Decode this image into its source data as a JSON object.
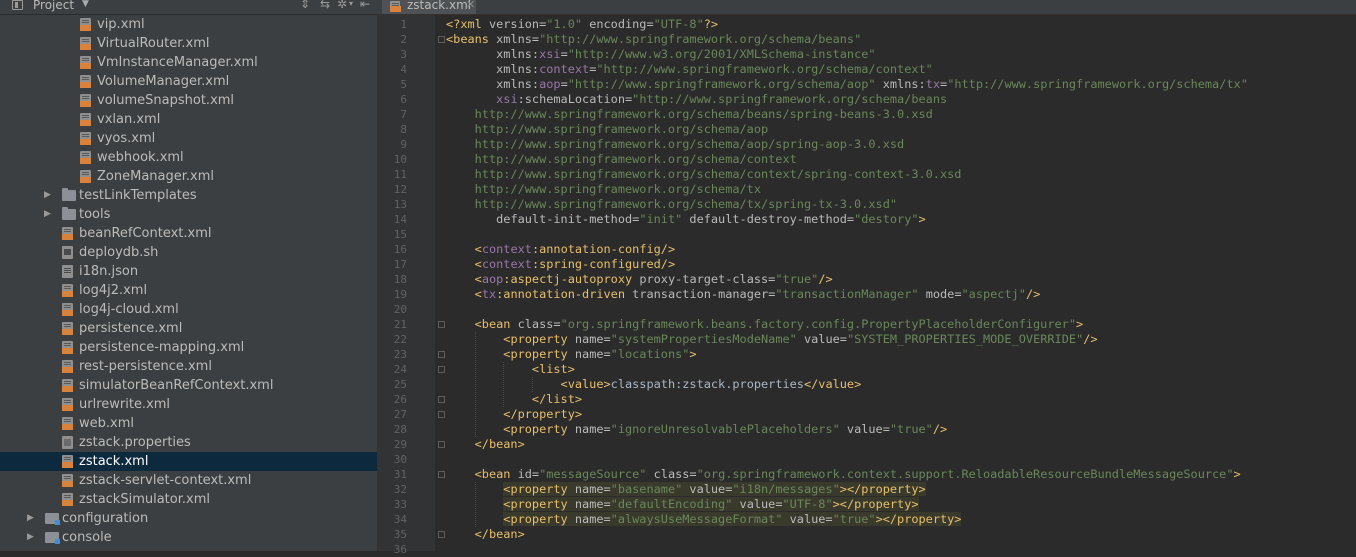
{
  "project_panel": {
    "title": "Project",
    "tree": [
      {
        "label": "vip.xml",
        "icon": "xml",
        "indent": 2
      },
      {
        "label": "VirtualRouter.xml",
        "icon": "xml",
        "indent": 2
      },
      {
        "label": "VmInstanceManager.xml",
        "icon": "xml",
        "indent": 2
      },
      {
        "label": "VolumeManager.xml",
        "icon": "xml",
        "indent": 2
      },
      {
        "label": "volumeSnapshot.xml",
        "icon": "xml",
        "indent": 2
      },
      {
        "label": "vxlan.xml",
        "icon": "xml",
        "indent": 2
      },
      {
        "label": "vyos.xml",
        "icon": "xml",
        "indent": 2
      },
      {
        "label": "webhook.xml",
        "icon": "xml",
        "indent": 2
      },
      {
        "label": "ZoneManager.xml",
        "icon": "xml",
        "indent": 2
      },
      {
        "label": "testLinkTemplates",
        "icon": "folder",
        "indent": 1,
        "collapsed": true
      },
      {
        "label": "tools",
        "icon": "folder",
        "indent": 1,
        "collapsed": true
      },
      {
        "label": "beanRefContext.xml",
        "icon": "xml",
        "indent": 1
      },
      {
        "label": "deploydb.sh",
        "icon": "sh",
        "indent": 1
      },
      {
        "label": "i18n.json",
        "icon": "json",
        "indent": 1
      },
      {
        "label": "log4j2.xml",
        "icon": "xml",
        "indent": 1
      },
      {
        "label": "log4j-cloud.xml",
        "icon": "xml",
        "indent": 1
      },
      {
        "label": "persistence.xml",
        "icon": "xml",
        "indent": 1
      },
      {
        "label": "persistence-mapping.xml",
        "icon": "xml",
        "indent": 1
      },
      {
        "label": "rest-persistence.xml",
        "icon": "xml",
        "indent": 1
      },
      {
        "label": "simulatorBeanRefContext.xml",
        "icon": "xml",
        "indent": 1
      },
      {
        "label": "urlrewrite.xml",
        "icon": "xml",
        "indent": 1
      },
      {
        "label": "web.xml",
        "icon": "xml",
        "indent": 1
      },
      {
        "label": "zstack.properties",
        "icon": "prop",
        "indent": 1
      },
      {
        "label": "zstack.xml",
        "icon": "xml",
        "indent": 1,
        "selected": true
      },
      {
        "label": "zstack-servlet-context.xml",
        "icon": "xml",
        "indent": 1
      },
      {
        "label": "zstackSimulator.xml",
        "icon": "xml",
        "indent": 1
      },
      {
        "label": "configuration",
        "icon": "module",
        "indent": 0,
        "collapsed": true
      },
      {
        "label": "console",
        "icon": "module",
        "indent": 0,
        "collapsed": true
      }
    ]
  },
  "editor": {
    "active_tab": "zstack.xml",
    "lines": [
      {
        "n": "1",
        "indent": "",
        "segs": [
          [
            "t",
            "<?xml "
          ],
          [
            "a",
            "version="
          ],
          [
            "v",
            "\"1.0\""
          ],
          [
            "a",
            " encoding="
          ],
          [
            "v",
            "\"UTF-8\""
          ],
          [
            "t",
            "?>"
          ]
        ]
      },
      {
        "n": "2",
        "indent": "",
        "fold": true,
        "segs": [
          [
            "t",
            "<beans "
          ],
          [
            "a",
            "xmlns="
          ],
          [
            "v",
            "\"http://www.springframework.org/schema/beans\""
          ]
        ]
      },
      {
        "n": "3",
        "indent": "       ",
        "segs": [
          [
            "a",
            "xmlns:"
          ],
          [
            "n",
            "xsi"
          ],
          [
            "a",
            "="
          ],
          [
            "v",
            "\"http://www.w3.org/2001/XMLSchema-instance\""
          ]
        ]
      },
      {
        "n": "4",
        "indent": "       ",
        "segs": [
          [
            "a",
            "xmlns:"
          ],
          [
            "n",
            "context"
          ],
          [
            "a",
            "="
          ],
          [
            "v",
            "\"http://www.springframework.org/schema/context\""
          ]
        ]
      },
      {
        "n": "5",
        "indent": "       ",
        "segs": [
          [
            "a",
            "xmlns:"
          ],
          [
            "n",
            "aop"
          ],
          [
            "a",
            "="
          ],
          [
            "v",
            "\"http://www.springframework.org/schema/aop\""
          ],
          [
            "a",
            " xmlns:"
          ],
          [
            "n",
            "tx"
          ],
          [
            "a",
            "="
          ],
          [
            "v",
            "\"http://www.springframework.org/schema/tx\""
          ]
        ]
      },
      {
        "n": "6",
        "indent": "       ",
        "segs": [
          [
            "n",
            "xsi"
          ],
          [
            "a",
            ":schemaLocation="
          ],
          [
            "v",
            "\"http://www.springframework.org/schema/beans"
          ]
        ]
      },
      {
        "n": "7",
        "indent": "    ",
        "segs": [
          [
            "v",
            "http://www.springframework.org/schema/beans/spring-beans-3.0.xsd"
          ]
        ]
      },
      {
        "n": "8",
        "indent": "    ",
        "segs": [
          [
            "v",
            "http://www.springframework.org/schema/aop"
          ]
        ]
      },
      {
        "n": "9",
        "indent": "    ",
        "segs": [
          [
            "v",
            "http://www.springframework.org/schema/aop/spring-aop-3.0.xsd"
          ]
        ]
      },
      {
        "n": "10",
        "indent": "    ",
        "segs": [
          [
            "v",
            "http://www.springframework.org/schema/context"
          ]
        ]
      },
      {
        "n": "11",
        "indent": "    ",
        "segs": [
          [
            "v",
            "http://www.springframework.org/schema/context/spring-context-3.0.xsd"
          ]
        ]
      },
      {
        "n": "12",
        "indent": "    ",
        "segs": [
          [
            "v",
            "http://www.springframework.org/schema/tx"
          ]
        ]
      },
      {
        "n": "13",
        "indent": "    ",
        "segs": [
          [
            "v",
            "http://www.springframework.org/schema/tx/spring-tx-3.0.xsd\""
          ]
        ]
      },
      {
        "n": "14",
        "indent": "       ",
        "segs": [
          [
            "a",
            "default-init-method="
          ],
          [
            "v",
            "\"init\""
          ],
          [
            "a",
            " default-destroy-method="
          ],
          [
            "v",
            "\"destory\""
          ],
          [
            "t",
            ">"
          ]
        ]
      },
      {
        "n": "15",
        "indent": "",
        "segs": []
      },
      {
        "n": "16",
        "indent": "    ",
        "segs": [
          [
            "t",
            "<"
          ],
          [
            "n",
            "context"
          ],
          [
            "t",
            ":annotation-config/>"
          ]
        ]
      },
      {
        "n": "17",
        "indent": "    ",
        "segs": [
          [
            "t",
            "<"
          ],
          [
            "n",
            "context"
          ],
          [
            "t",
            ":spring-configured/>"
          ]
        ]
      },
      {
        "n": "18",
        "indent": "    ",
        "segs": [
          [
            "t",
            "<"
          ],
          [
            "n",
            "aop"
          ],
          [
            "t",
            ":aspectj-autoproxy "
          ],
          [
            "a",
            "proxy-target-class="
          ],
          [
            "v",
            "\"true\""
          ],
          [
            "t",
            "/>"
          ]
        ]
      },
      {
        "n": "19",
        "indent": "    ",
        "segs": [
          [
            "t",
            "<"
          ],
          [
            "n",
            "tx"
          ],
          [
            "t",
            ":annotation-driven "
          ],
          [
            "a",
            "transaction-manager="
          ],
          [
            "v",
            "\"transactionManager\""
          ],
          [
            "a",
            " mode="
          ],
          [
            "v",
            "\"aspectj\""
          ],
          [
            "t",
            "/>"
          ]
        ]
      },
      {
        "n": "20",
        "indent": "",
        "segs": []
      },
      {
        "n": "21",
        "indent": "    ",
        "fold": true,
        "segs": [
          [
            "t",
            "<bean "
          ],
          [
            "a",
            "class="
          ],
          [
            "v",
            "\"org.springframework.beans.factory.config.PropertyPlaceholderConfigurer\""
          ],
          [
            "t",
            ">"
          ]
        ]
      },
      {
        "n": "22",
        "indent": "        ",
        "segs": [
          [
            "t",
            "<property "
          ],
          [
            "a",
            "name="
          ],
          [
            "v",
            "\"systemPropertiesModeName\""
          ],
          [
            "a",
            " value="
          ],
          [
            "v",
            "\"SYSTEM_PROPERTIES_MODE_OVERRIDE\""
          ],
          [
            "t",
            "/>"
          ]
        ]
      },
      {
        "n": "23",
        "indent": "        ",
        "fold": true,
        "segs": [
          [
            "t",
            "<property "
          ],
          [
            "a",
            "name="
          ],
          [
            "v",
            "\"locations\""
          ],
          [
            "t",
            ">"
          ]
        ]
      },
      {
        "n": "24",
        "indent": "            ",
        "fold": true,
        "segs": [
          [
            "t",
            "<list>"
          ]
        ]
      },
      {
        "n": "25",
        "indent": "                ",
        "segs": [
          [
            "t",
            "<value>"
          ],
          [
            "p",
            "classpath:zstack.properties"
          ],
          [
            "t",
            "</value>"
          ]
        ]
      },
      {
        "n": "26",
        "indent": "            ",
        "fold": true,
        "segs": [
          [
            "t",
            "</list>"
          ]
        ]
      },
      {
        "n": "27",
        "indent": "        ",
        "fold": true,
        "segs": [
          [
            "t",
            "</property>"
          ]
        ]
      },
      {
        "n": "28",
        "indent": "        ",
        "segs": [
          [
            "t",
            "<property "
          ],
          [
            "a",
            "name="
          ],
          [
            "v",
            "\"ignoreUnresolvablePlaceholders\""
          ],
          [
            "a",
            " value="
          ],
          [
            "v",
            "\"true\""
          ],
          [
            "t",
            "/>"
          ]
        ]
      },
      {
        "n": "29",
        "indent": "    ",
        "fold": true,
        "segs": [
          [
            "t",
            "</bean>"
          ]
        ]
      },
      {
        "n": "30",
        "indent": "",
        "segs": []
      },
      {
        "n": "31",
        "indent": "    ",
        "fold": true,
        "segs": [
          [
            "t",
            "<bean "
          ],
          [
            "a",
            "id="
          ],
          [
            "v",
            "\"messageSource\""
          ],
          [
            "a",
            " class="
          ],
          [
            "v",
            "\"org.springframework.context.support.ReloadableResourceBundleMessageSource\""
          ],
          [
            "t",
            ">"
          ]
        ]
      },
      {
        "n": "32",
        "indent": "        ",
        "hl": true,
        "segs": [
          [
            "t",
            "<property "
          ],
          [
            "a",
            "name="
          ],
          [
            "v",
            "\"basename\""
          ],
          [
            "a",
            " value="
          ],
          [
            "v",
            "\"i18n/messages\""
          ],
          [
            "t",
            "></property>"
          ]
        ]
      },
      {
        "n": "33",
        "indent": "        ",
        "hl": true,
        "segs": [
          [
            "t",
            "<property "
          ],
          [
            "a",
            "name="
          ],
          [
            "v",
            "\"defaultEncoding\""
          ],
          [
            "a",
            " value="
          ],
          [
            "v",
            "\"UTF-8\""
          ],
          [
            "t",
            "></property>"
          ]
        ]
      },
      {
        "n": "34",
        "indent": "        ",
        "hl": true,
        "segs": [
          [
            "t",
            "<property "
          ],
          [
            "a",
            "name="
          ],
          [
            "v",
            "\"alwaysUseMessageFormat\""
          ],
          [
            "a",
            " value="
          ],
          [
            "v",
            "\"true\""
          ],
          [
            "t",
            "></property>"
          ]
        ]
      },
      {
        "n": "35",
        "indent": "    ",
        "fold": true,
        "segs": [
          [
            "t",
            "</bean>"
          ]
        ]
      },
      {
        "n": "36",
        "indent": "",
        "segs": []
      }
    ]
  }
}
